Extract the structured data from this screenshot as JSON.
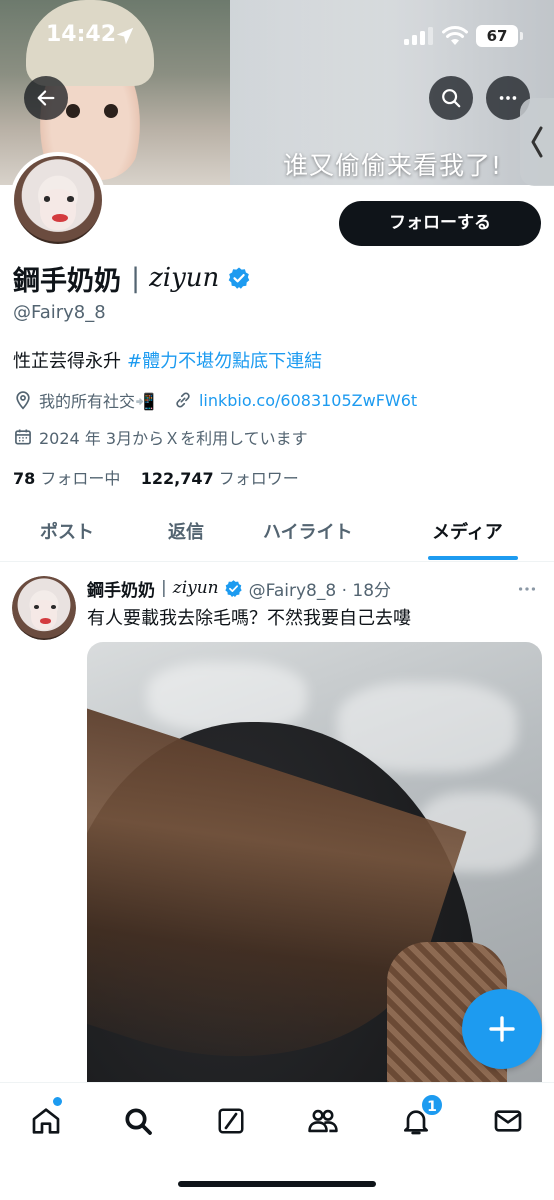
{
  "status_bar": {
    "time": "14:42",
    "battery": "67"
  },
  "banner": {
    "caption": "谁又偷偷来看我了!"
  },
  "profile": {
    "display_name": "鋼手奶奶",
    "name_separator": "|",
    "display_name_alt": "ziyun",
    "handle": "@Fairy8_8",
    "bio_text": "性芷芸得永升",
    "bio_hashtag": "#體力不堪勿點底下連結",
    "location": "我的所有社交📲",
    "link": "linkbio.co/6083105ZwFW6t",
    "joined": "2024 年 3月からＸを利用しています",
    "following_count": "78",
    "following_label": "フォロー中",
    "followers_count": "122,747",
    "followers_label": "フォロワー",
    "follow_button": "フォローする"
  },
  "tabs": [
    {
      "label": "ポスト"
    },
    {
      "label": "返信"
    },
    {
      "label": "ハイライト"
    },
    {
      "label": "メディア"
    }
  ],
  "active_tab": "メディア",
  "post": {
    "author_name": "鋼手奶奶",
    "separator": "|",
    "author_name_alt": "ziyun",
    "handle_time": "@Fairy8_8 · 18分",
    "text": "有人要載我去除毛嗎？不然我要自己去嘍"
  },
  "bottom_nav": {
    "items": [
      "home-icon",
      "search-icon",
      "grok-icon",
      "communities-icon",
      "notifications-icon",
      "messages-icon"
    ],
    "notification_badge": "1"
  },
  "colors": {
    "accent": "#1d9bf0",
    "text": "#0f1419",
    "secondary": "#536471"
  }
}
